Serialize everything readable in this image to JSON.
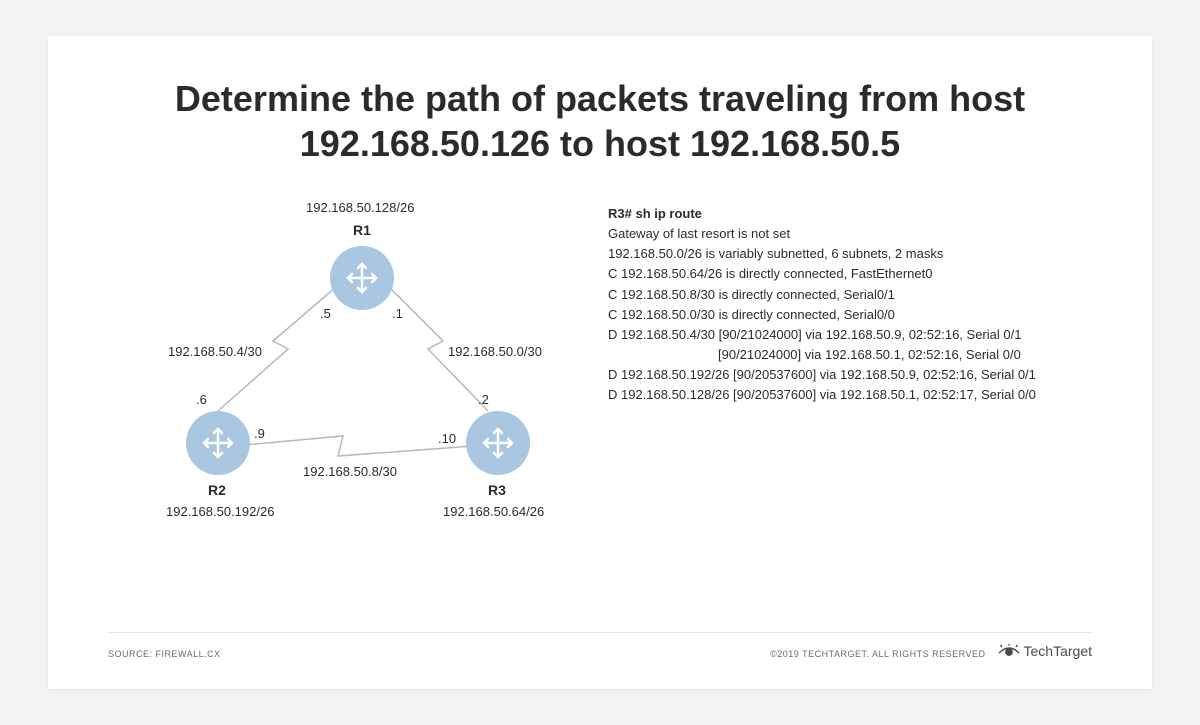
{
  "title": "Determine the path of packets traveling from host 192.168.50.126 to host 192.168.50.5",
  "diagram": {
    "r1": {
      "name": "R1",
      "top_subnet": "192.168.50.128/26",
      "int_left": ".5",
      "int_right": ".1"
    },
    "r2": {
      "name": "R2",
      "bottom_subnet": "192.168.50.192/26",
      "int_top": ".6",
      "int_right": ".9"
    },
    "r3": {
      "name": "R3",
      "bottom_subnet": "192.168.50.64/26",
      "int_top": ".2",
      "int_left": ".10"
    },
    "link_r1_r2": "192.168.50.4/30",
    "link_r1_r3": "192.168.50.0/30",
    "link_r2_r3": "192.168.50.8/30"
  },
  "route_output": {
    "prompt": "R3# sh ip route",
    "gw": "Gateway of last resort is not set",
    "lines": [
      "192.168.50.0/26  is variably subnetted, 6 subnets, 2 masks",
      "C 192.168.50.64/26 is directly connected, FastEthernet0",
      "C 192.168.50.8/30 is directly connected, Serial0/1",
      "C 192.168.50.0/30 is directly connected, Serial0/0",
      "D 192.168.50.4/30 [90/21024000] via 192.168.50.9, 02:52:16, Serial 0/1",
      "[90/21024000] via 192.168.50.1, 02:52:16, Serial 0/0",
      "D 192.168.50.192/26 [90/20537600] via 192.168.50.9, 02:52:16, Serial 0/1",
      "D 192.168.50.128/26 [90/20537600] via 192.168.50.1, 02:52:17, Serial 0/0"
    ]
  },
  "footer": {
    "source": "SOURCE: FIREWALL.CX",
    "copyright": "©2019 TECHTARGET. ALL RIGHTS RESERVED",
    "brand": "TechTarget"
  }
}
